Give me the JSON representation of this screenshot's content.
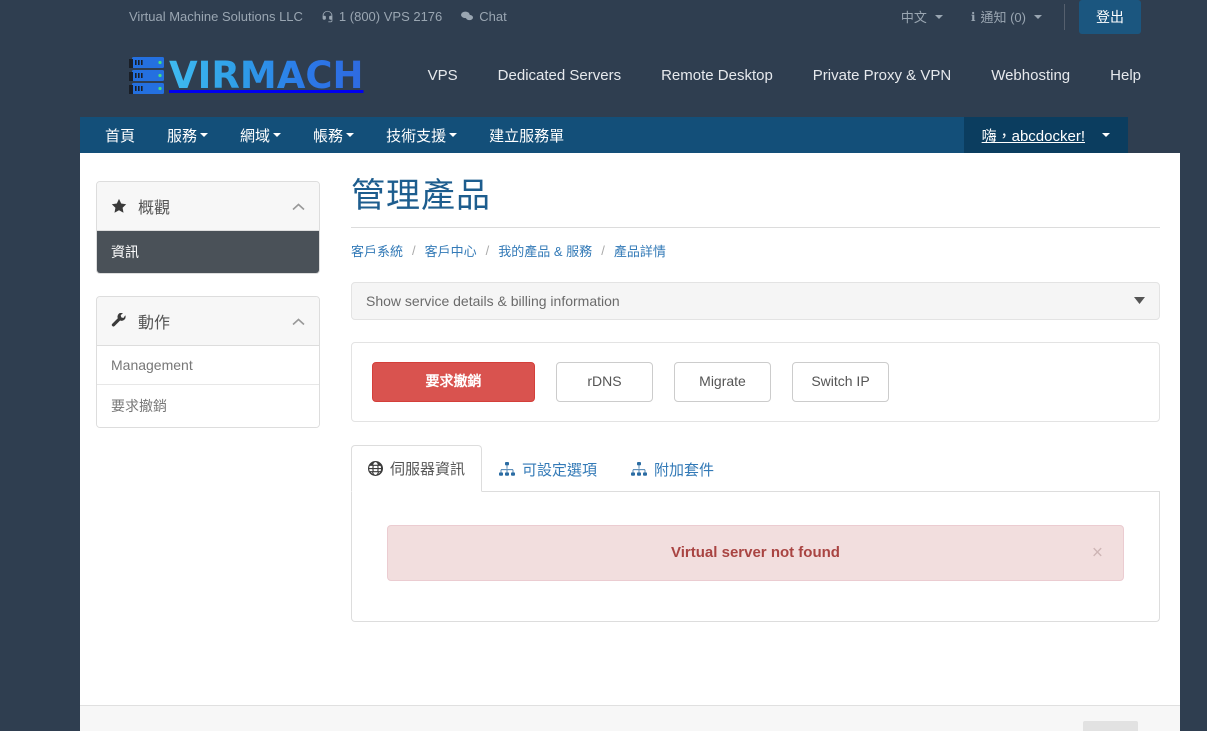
{
  "topbar": {
    "company": "Virtual Machine Solutions LLC",
    "phone": "1 (800) VPS 2176",
    "chat": "Chat",
    "language": "中文",
    "notifications": "通知 (0)",
    "logout": "登出",
    "icons": {
      "headset": "headset-icon",
      "chat": "chat-icon",
      "info": "info-icon"
    }
  },
  "brand": {
    "logo_text": "VIRMACH",
    "logo_mark": "server-rack-icon",
    "gradient_start": "#3fbbf0",
    "gradient_end": "#2e6ae0"
  },
  "mainnav": {
    "items": [
      {
        "label": "VPS"
      },
      {
        "label": "Dedicated Servers"
      },
      {
        "label": "Remote Desktop"
      },
      {
        "label": "Private Proxy & VPN"
      },
      {
        "label": "Webhosting"
      },
      {
        "label": "Help"
      }
    ]
  },
  "bluenav": {
    "items": [
      {
        "label": "首頁",
        "caret": false
      },
      {
        "label": "服務",
        "caret": true
      },
      {
        "label": "網域",
        "caret": true
      },
      {
        "label": "帳務",
        "caret": true
      },
      {
        "label": "技術支援",
        "caret": true
      },
      {
        "label": "建立服務單",
        "caret": false
      }
    ],
    "user": "嗨，abcdocker!",
    "bg": "#134f79",
    "user_bg": "#0b3d5f"
  },
  "sidebar": {
    "panels": [
      {
        "title": "概觀",
        "icon": "star-icon",
        "chevron": "chevron-up-icon",
        "items": [
          {
            "label": "資訊",
            "active": true
          }
        ]
      },
      {
        "title": "動作",
        "icon": "wrench-icon",
        "chevron": "chevron-up-icon",
        "items": [
          {
            "label": "Management",
            "active": false
          },
          {
            "label": "要求撤銷",
            "active": false
          }
        ]
      }
    ]
  },
  "main": {
    "page_title": "管理產品",
    "title_color": "#1d5d8e",
    "breadcrumb": [
      {
        "label": "客戶系統"
      },
      {
        "label": "客戶中心"
      },
      {
        "label": "我的產品 & 服務"
      },
      {
        "label": "產品詳情"
      }
    ],
    "breadcrumb_separator": "/",
    "collapse_panel": {
      "label": "Show service details & billing information",
      "caret": "caret-down-icon"
    },
    "action_buttons": [
      {
        "label": "要求撤銷",
        "style": "danger",
        "color": "#d9534f"
      },
      {
        "label": "rDNS",
        "style": "default"
      },
      {
        "label": "Migrate",
        "style": "default"
      },
      {
        "label": "Switch IP",
        "style": "default"
      }
    ],
    "tabs": [
      {
        "label": "伺服器資訊",
        "icon": "globe-icon",
        "active": true
      },
      {
        "label": "可設定選項",
        "icon": "sitemap-icon",
        "active": false
      },
      {
        "label": "附加套件",
        "icon": "sitemap-icon",
        "active": false
      }
    ],
    "alert": {
      "message": "Virtual server not found",
      "close": "×",
      "bg": "#f2dede",
      "text_color": "#a94442"
    }
  }
}
